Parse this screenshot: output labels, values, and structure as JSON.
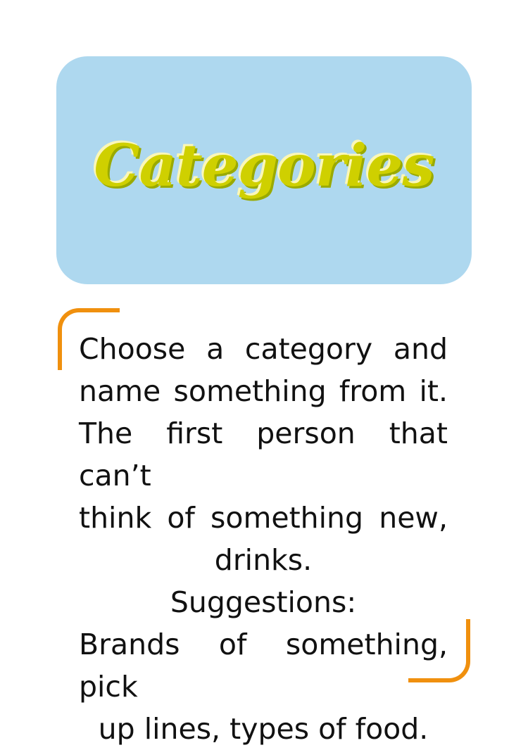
{
  "card": {
    "title": "Categories",
    "instructions": [
      "Choose a category and",
      "name something from it.",
      "The first person that can’t",
      "think of something new,"
    ],
    "instructions_end": "drinks.",
    "suggestions_label": "Suggestions:",
    "suggestions": [
      "Brands of something, pick",
      "up lines, types of food."
    ]
  },
  "colors": {
    "title_box": "#aed8ef",
    "title_text": "#cfd000",
    "bracket": "#f0900e"
  }
}
